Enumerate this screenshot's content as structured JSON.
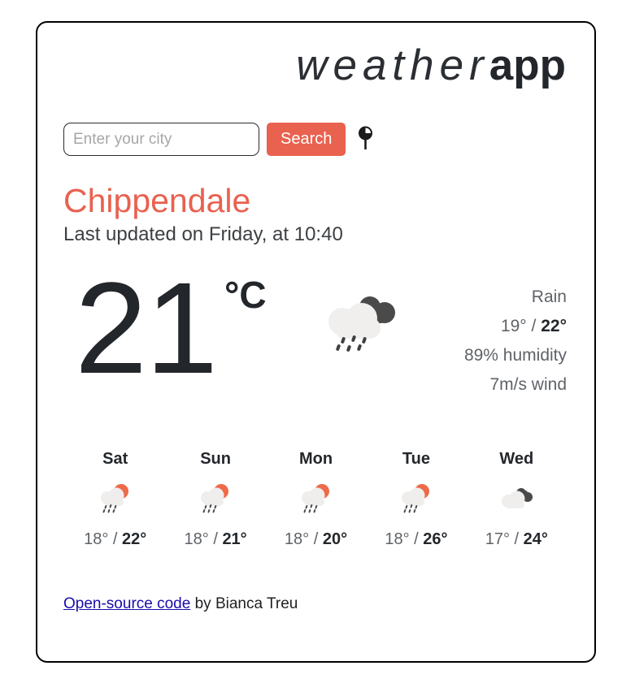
{
  "brand": {
    "light_part": "weather",
    "bold_part": "app"
  },
  "search": {
    "placeholder": "Enter your city",
    "value": "",
    "button_label": "Search",
    "pin_icon": "location-pin-icon"
  },
  "current": {
    "city": "Chippendale",
    "last_updated": "Last updated on Friday, at 10:40",
    "temperature": "21",
    "unit": "°C",
    "icon": "rain-icon",
    "description": "Rain",
    "temp_min": "19°",
    "temp_separator": " / ",
    "temp_max": "22°",
    "humidity": "89% humidity",
    "wind": "7m/s wind"
  },
  "forecast": [
    {
      "day": "Sat",
      "icon": "sun-cloud-rain-icon",
      "temp_min": "18°",
      "temp_separator": " / ",
      "temp_max": "22°"
    },
    {
      "day": "Sun",
      "icon": "sun-cloud-rain-icon",
      "temp_min": "18°",
      "temp_separator": " / ",
      "temp_max": "21°"
    },
    {
      "day": "Mon",
      "icon": "sun-cloud-rain-icon",
      "temp_min": "18°",
      "temp_separator": " / ",
      "temp_max": "20°"
    },
    {
      "day": "Tue",
      "icon": "sun-cloud-rain-icon",
      "temp_min": "18°",
      "temp_separator": " / ",
      "temp_max": "26°"
    },
    {
      "day": "Wed",
      "icon": "overcast-cloud-icon",
      "temp_min": "17°",
      "temp_separator": " / ",
      "temp_max": "24°"
    }
  ],
  "footer": {
    "link_label": "Open-source code",
    "author_text": " by Bianca Treu"
  },
  "colors": {
    "accent": "#e9614f",
    "link": "#1a0dab",
    "text_dark": "#23272b",
    "text_muted": "#5f6368",
    "cloud_light": "#f0efee",
    "cloud_dark": "#4a4a4a"
  }
}
